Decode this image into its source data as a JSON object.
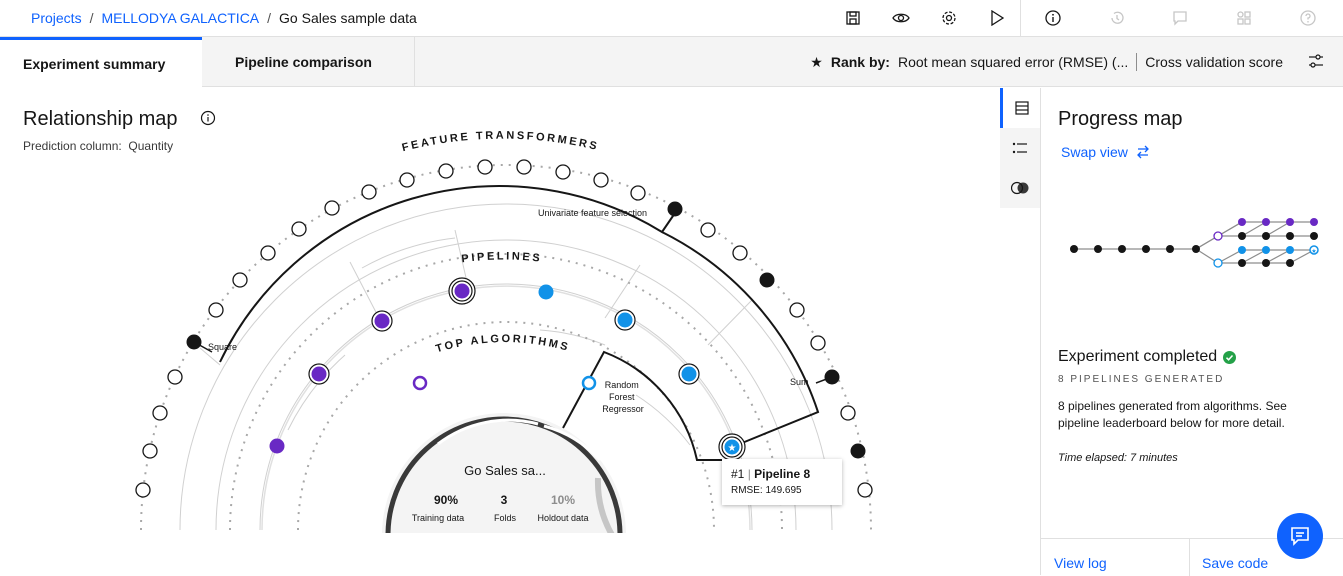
{
  "breadcrumb": {
    "projects": "Projects",
    "project": "MELLODYA GALACTICA",
    "current": "Go Sales sample data"
  },
  "toolbar": {
    "icons": [
      "save-icon",
      "view-icon",
      "settings-icon",
      "run-icon",
      "info-icon",
      "history-icon",
      "comments-icon",
      "components-icon",
      "help-icon"
    ]
  },
  "tabs": [
    {
      "label": "Experiment summary",
      "active": true
    },
    {
      "label": "Pipeline comparison",
      "active": false
    }
  ],
  "rank": {
    "label": "Rank by:",
    "metric": "Root mean squared error (RMSE) (...",
    "score": "Cross validation score"
  },
  "relationship_map": {
    "title": "Relationship map",
    "prediction_label": "Prediction column:",
    "prediction_value": "Quantity",
    "rings": {
      "feature_transformers": "FEATURE TRANSFORMERS",
      "pipelines": "PIPELINES",
      "top_algorithms": "TOP ALGORITHMS"
    },
    "transformer_labels": {
      "square": "Square",
      "univariate": "Univariate feature selection",
      "sum": "Sum"
    },
    "algorithm_label": [
      "Random",
      "Forest",
      "Regressor"
    ],
    "center": {
      "title": "Go Sales sa...",
      "training_value": "90%",
      "training_label": "Training data",
      "folds_value": "3",
      "folds_label": "Folds",
      "holdout_value": "10%",
      "holdout_label": "Holdout data"
    },
    "tooltip": {
      "rank": "#1",
      "pipeline": "Pipeline 8",
      "metric": "RMSE: 149.695"
    }
  },
  "colors": {
    "accent": "#0f62fe",
    "purple": "#6929c4",
    "cyan": "#1192e8",
    "success": "#24a148"
  },
  "progress_map": {
    "title": "Progress map",
    "swap": "Swap view",
    "status": "Experiment completed",
    "generated": "8 PIPELINES GENERATED",
    "description": "8 pipelines generated from algorithms. See pipeline leaderboard below for more detail.",
    "elapsed": "Time elapsed: 7 minutes",
    "view_log": "View log",
    "save_code": "Save code"
  }
}
